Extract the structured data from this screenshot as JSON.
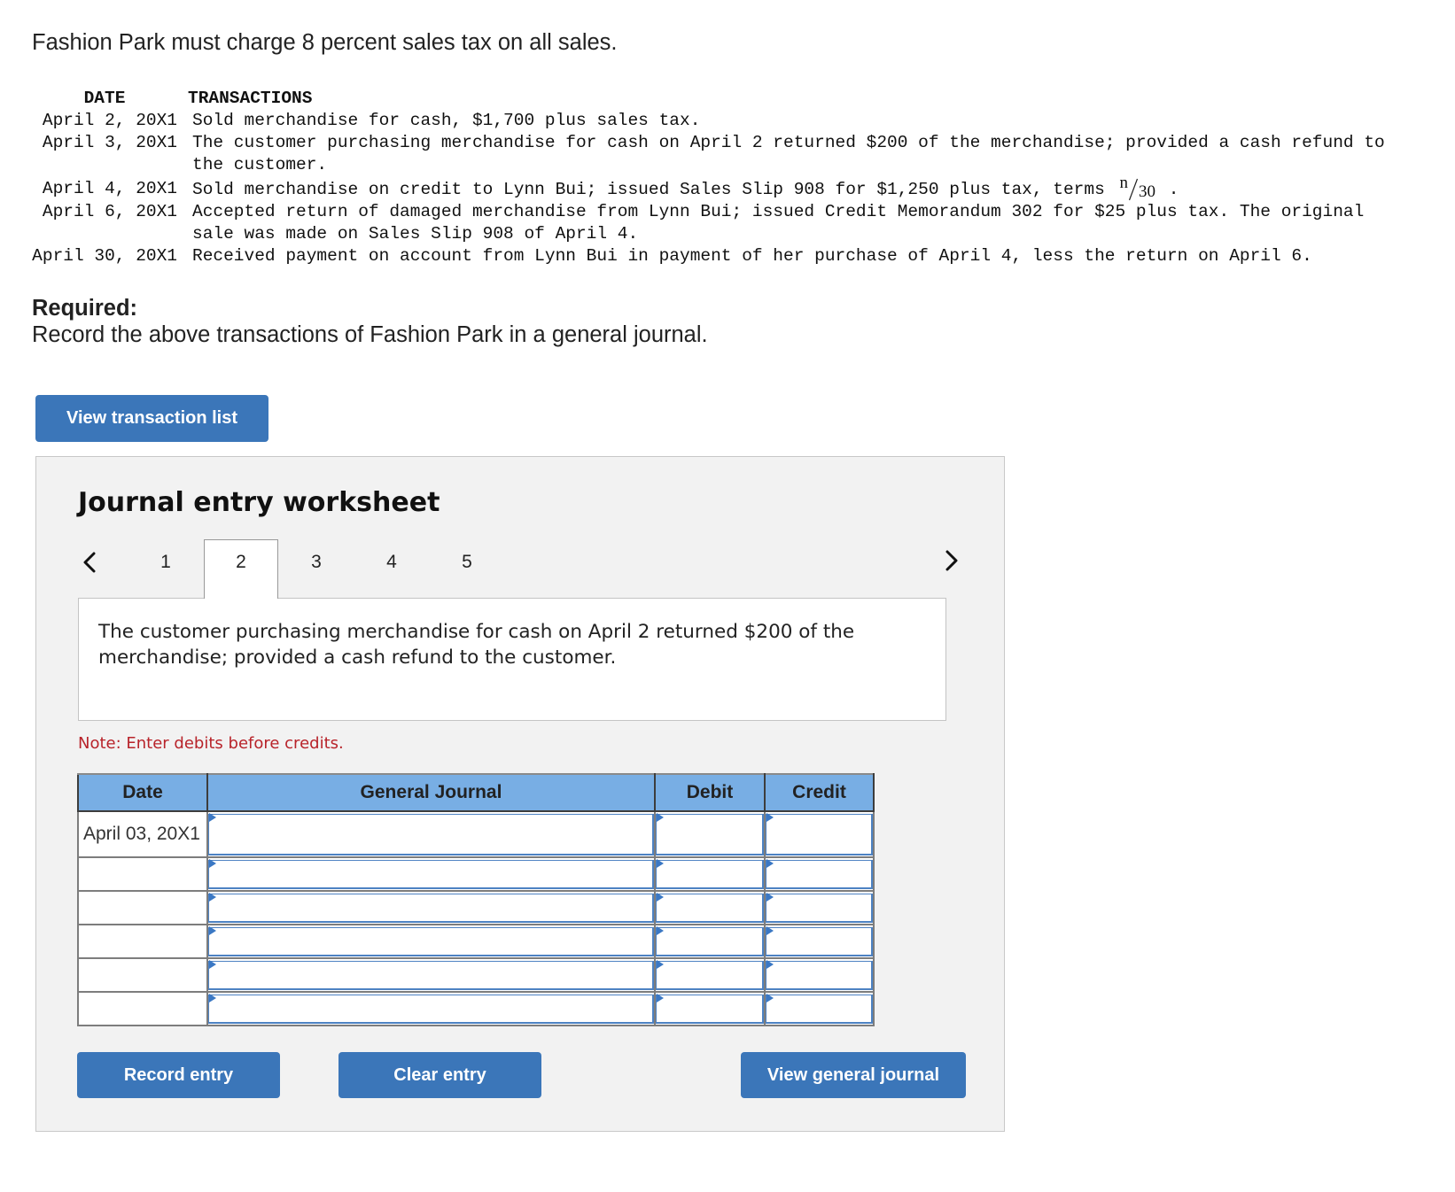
{
  "theme": {
    "accent": "#3b76b9",
    "table_header_bg": "#78aee4",
    "note_color": "#b8232a",
    "input_border": "#4d82c3",
    "input_marker": "#3b78c4",
    "panel_bg": "#f2f2f2"
  },
  "intro": "Fashion Park must charge 8 percent sales tax on all sales.",
  "transactions": {
    "header_date": "DATE",
    "header_transactions": "TRANSACTIONS",
    "rows": [
      {
        "date": "April 2, 20X1",
        "text": "Sold merchandise for cash, $1,700 plus sales tax."
      },
      {
        "date": "April 3, 20X1",
        "text": "The customer purchasing merchandise for cash on April 2 returned $200 of the merchandise; provided a cash refund to the customer."
      },
      {
        "date": "April 4, 20X1",
        "text": "Sold merchandise on credit to Lynn Bui; issued Sales Slip 908 for $1,250 plus tax, terms",
        "terms_numerator": "n",
        "terms_denominator": "30",
        "text_after": "."
      },
      {
        "date": "April 6, 20X1",
        "text": "Accepted return of damaged merchandise from Lynn Bui; issued Credit Memorandum 302 for $25 plus tax. The original sale was made on Sales Slip 908 of April 4."
      },
      {
        "date": "April 30, 20X1",
        "text": "Received payment on account from Lynn Bui in payment of her purchase of April 4, less the return on April 6."
      }
    ]
  },
  "required": {
    "label": "Required:",
    "text": "Record the above transactions of Fashion Park in a general journal."
  },
  "view_transaction_list_button": "View transaction list",
  "worksheet": {
    "title": "Journal entry worksheet",
    "prev_icon": "chevron-left-icon",
    "next_icon": "chevron-right-icon",
    "tabs": [
      "1",
      "2",
      "3",
      "4",
      "5"
    ],
    "active_tab": 2,
    "description": "The customer purchasing merchandise for cash on April 2 returned $200 of the merchandise; provided a cash refund to the customer.",
    "note": "Note: Enter debits before credits.",
    "table": {
      "columns": [
        "Date",
        "General Journal",
        "Debit",
        "Credit"
      ],
      "rows": [
        {
          "date": "April 03, 20X1",
          "account": "",
          "debit": "",
          "credit": ""
        },
        {
          "date": "",
          "account": "",
          "debit": "",
          "credit": ""
        },
        {
          "date": "",
          "account": "",
          "debit": "",
          "credit": ""
        },
        {
          "date": "",
          "account": "",
          "debit": "",
          "credit": ""
        },
        {
          "date": "",
          "account": "",
          "debit": "",
          "credit": ""
        },
        {
          "date": "",
          "account": "",
          "debit": "",
          "credit": ""
        }
      ]
    },
    "buttons": {
      "record": "Record entry",
      "clear": "Clear entry",
      "view_general_journal": "View general journal"
    }
  }
}
